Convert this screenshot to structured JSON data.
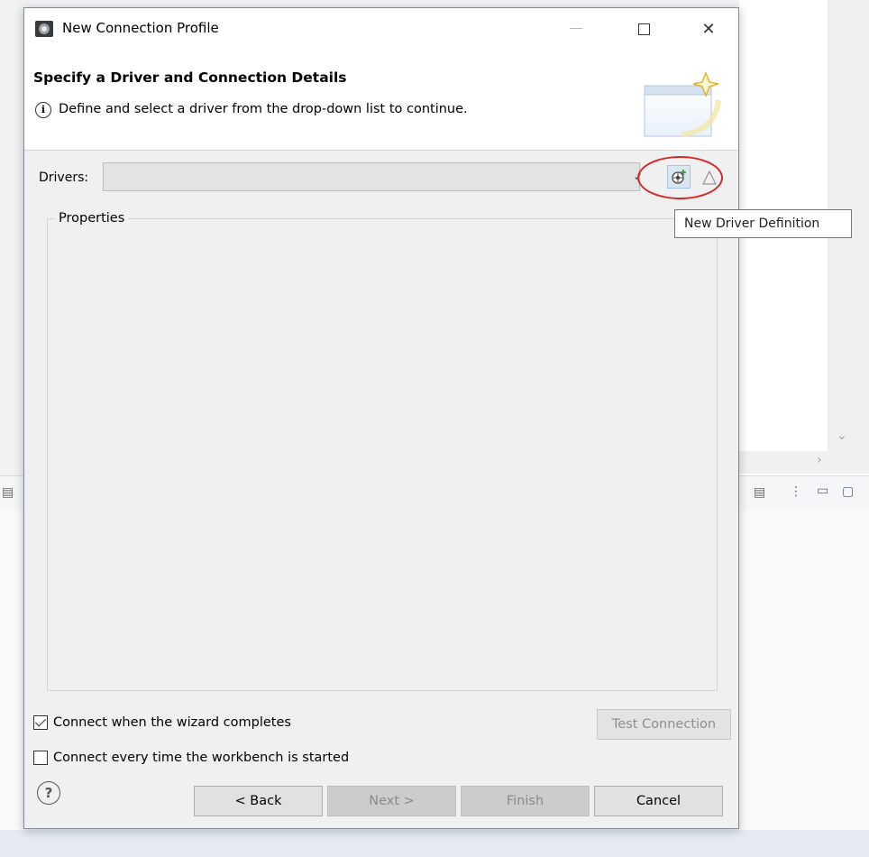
{
  "window": {
    "title": "New Connection Profile",
    "icons": {
      "app": "eclipse-connection-icon",
      "minimize": "minimize-icon",
      "maximize": "maximize-icon",
      "close": "close-icon"
    },
    "close_glyph": "✕"
  },
  "header": {
    "title": "Specify a Driver and Connection Details",
    "message": "Define and select a driver from the drop-down list to continue.",
    "info_glyph": "i"
  },
  "drivers": {
    "label": "Drivers:",
    "selected_value": "",
    "new_driver_tooltip": "New Driver Definition"
  },
  "properties": {
    "label": "Properties"
  },
  "options": {
    "connect_on_complete": {
      "label": "Connect when the wizard completes",
      "checked": true
    },
    "connect_on_startup": {
      "label": "Connect every time the workbench is started",
      "checked": false
    }
  },
  "test_connection_label": "Test Connection",
  "footer": {
    "help_glyph": "?",
    "back_label": "< Back",
    "next_label": "Next >",
    "finish_label": "Finish",
    "cancel_label": "Cancel"
  },
  "colors": {
    "annotation": "#d42a2a",
    "header_bg": "#ffffff",
    "dialog_bg": "#f0f0f0"
  }
}
